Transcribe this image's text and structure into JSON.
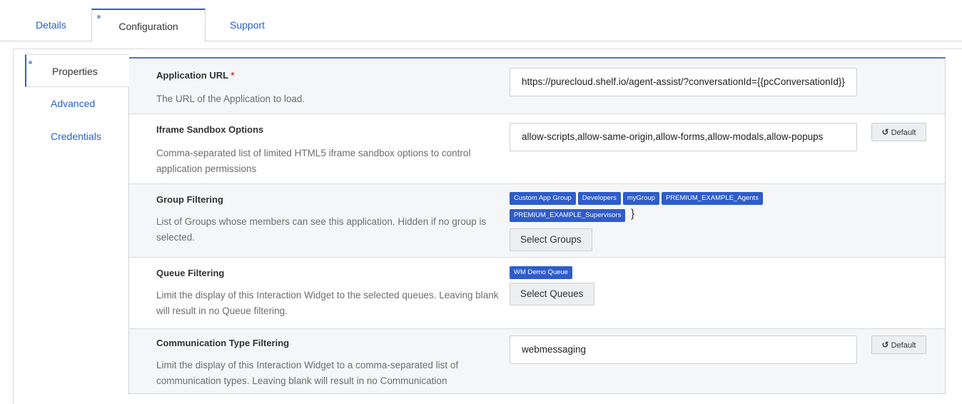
{
  "tabs": {
    "details": "Details",
    "configuration": "Configuration",
    "support": "Support"
  },
  "subtabs": {
    "properties": "Properties",
    "advanced": "Advanced",
    "credentials": "Credentials"
  },
  "rows": {
    "app_url": {
      "title": "Application URL",
      "required": "*",
      "desc": "The URL of the Application to load.",
      "value": "https://purecloud.shelf.io/agent-assist/?conversationId={{pcConversationId}}"
    },
    "sandbox": {
      "title": "Iframe Sandbox Options",
      "desc": "Comma-separated list of limited HTML5 iframe sandbox options to control application permissions",
      "value": "allow-scripts,allow-same-origin,allow-forms,allow-modals,allow-popups",
      "default_label": "Default"
    },
    "groups": {
      "title": "Group Filtering",
      "desc": "List of Groups whose members can see this application. Hidden if no group is selected.",
      "chips": [
        "Custom App Group",
        "Developers",
        "myGroup",
        "PREMIUM_EXAMPLE_Agents",
        "PREMIUM_EXAMPLE_Supervisors"
      ],
      "button": "Select Groups"
    },
    "queues": {
      "title": "Queue Filtering",
      "desc": "Limit the display of this Interaction Widget to the selected queues. Leaving blank will result in no Queue filtering.",
      "chips": [
        "WM Demo Queue"
      ],
      "button": "Select Queues"
    },
    "comm_types": {
      "title": "Communication Type Filtering",
      "desc": "Limit the display of this Interaction Widget to a comma-separated list of communication types. Leaving blank will result in no Communication",
      "value": "webmessaging",
      "default_label": "Default"
    }
  },
  "colors": {
    "accent": "#2a60c8",
    "chip": "#2e5ccc",
    "required": "#d9342b"
  }
}
